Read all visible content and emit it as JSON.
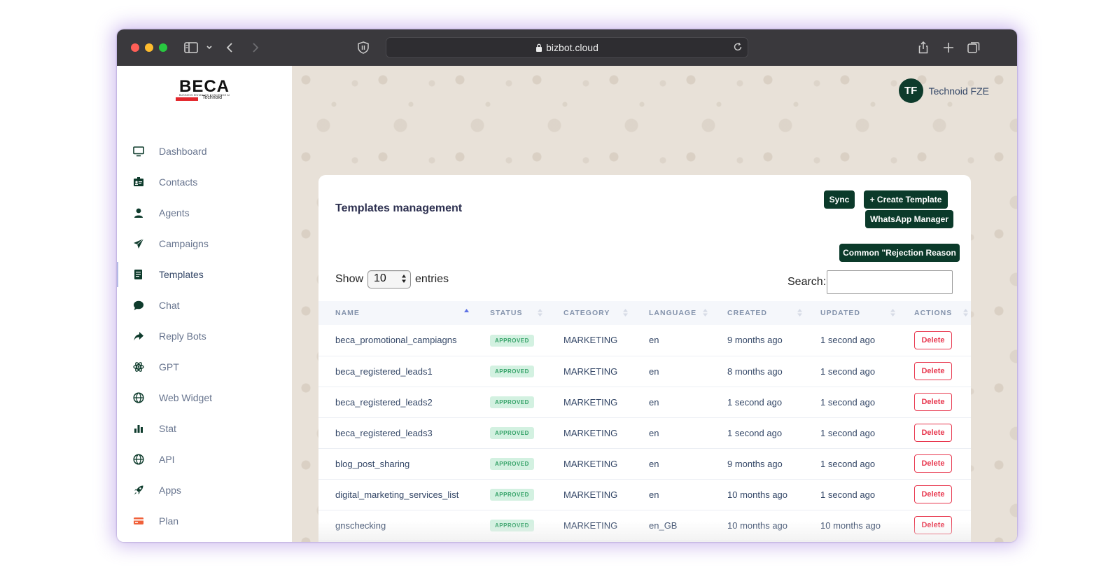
{
  "browser": {
    "url": "bizbot.cloud"
  },
  "sidebar": {
    "logo": {
      "text": "BECA",
      "tagline": "BUSINESS ENHANCED CONCIERGE AI",
      "brand": "Technoid"
    },
    "items": [
      {
        "label": "Dashboard",
        "icon": "monitor-icon"
      },
      {
        "label": "Contacts",
        "icon": "contact-card-icon"
      },
      {
        "label": "Agents",
        "icon": "user-icon"
      },
      {
        "label": "Campaigns",
        "icon": "paper-plane-icon"
      },
      {
        "label": "Templates",
        "icon": "document-icon",
        "active": true
      },
      {
        "label": "Chat",
        "icon": "chat-bubble-icon"
      },
      {
        "label": "Reply Bots",
        "icon": "share-arrow-icon"
      },
      {
        "label": "GPT",
        "icon": "atom-icon"
      },
      {
        "label": "Web Widget",
        "icon": "globe-icon"
      },
      {
        "label": "Stat",
        "icon": "bar-chart-icon"
      },
      {
        "label": "API",
        "icon": "globe-icon"
      },
      {
        "label": "Apps",
        "icon": "rocket-icon"
      },
      {
        "label": "Plan",
        "icon": "credit-card-icon"
      }
    ]
  },
  "user": {
    "initials": "TF",
    "name": "Technoid FZE"
  },
  "card": {
    "title": "Templates management",
    "buttons": {
      "sync": "Sync",
      "create": "+ Create Template",
      "manager": "WhatsApp Manager",
      "rejection": "Common \"Rejection Reason"
    },
    "show_label": "Show",
    "entries_value": "10",
    "entries_label": "entries",
    "search_label": "Search:",
    "search_value": ""
  },
  "table": {
    "columns": [
      "NAME",
      "STATUS",
      "CATEGORY",
      "LANGUAGE",
      "CREATED",
      "UPDATED",
      "ACTIONS"
    ],
    "rows": [
      {
        "name": "beca_promotional_campiagns",
        "status": "APPROVED",
        "category": "MARKETING",
        "language": "en",
        "created": "9 months ago",
        "updated": "1 second ago",
        "action": "Delete"
      },
      {
        "name": "beca_registered_leads1",
        "status": "APPROVED",
        "category": "MARKETING",
        "language": "en",
        "created": "8 months ago",
        "updated": "1 second ago",
        "action": "Delete"
      },
      {
        "name": "beca_registered_leads2",
        "status": "APPROVED",
        "category": "MARKETING",
        "language": "en",
        "created": "1 second ago",
        "updated": "1 second ago",
        "action": "Delete"
      },
      {
        "name": "beca_registered_leads3",
        "status": "APPROVED",
        "category": "MARKETING",
        "language": "en",
        "created": "1 second ago",
        "updated": "1 second ago",
        "action": "Delete"
      },
      {
        "name": "blog_post_sharing",
        "status": "APPROVED",
        "category": "MARKETING",
        "language": "en",
        "created": "9 months ago",
        "updated": "1 second ago",
        "action": "Delete"
      },
      {
        "name": "digital_marketing_services_list",
        "status": "APPROVED",
        "category": "MARKETING",
        "language": "en",
        "created": "10 months ago",
        "updated": "1 second ago",
        "action": "Delete"
      },
      {
        "name": "gnschecking",
        "status": "APPROVED",
        "category": "MARKETING",
        "language": "en_GB",
        "created": "10 months ago",
        "updated": "10 months ago",
        "action": "Delete"
      }
    ]
  },
  "colors": {
    "brand_green": "#0b3a2a",
    "delete_red": "#e8384f",
    "badge_green_bg": "#d3f1e1",
    "badge_green_text": "#35a268",
    "toolbar": "#3a393d",
    "pattern_bg": "#e8e1d8"
  }
}
